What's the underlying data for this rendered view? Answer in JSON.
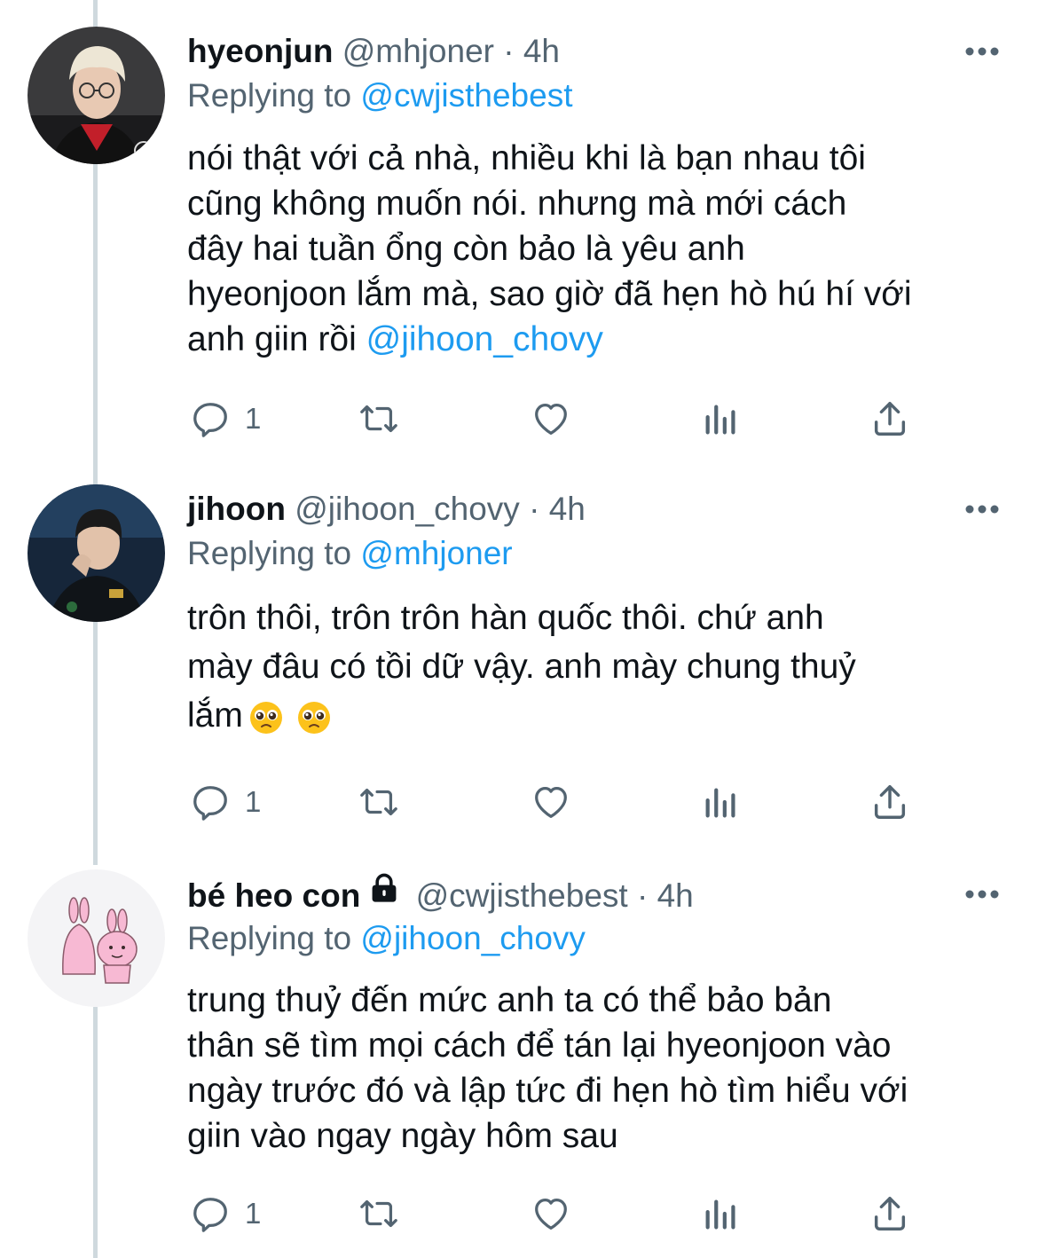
{
  "tweets": [
    {
      "name": "hyeonjun",
      "handle": "@mhjoner",
      "sep": "·",
      "time": "4h",
      "locked": false,
      "replying_prefix": "Replying to ",
      "replying_to": "@cwjisthebest",
      "body_text": "nói thật với cả nhà, nhiều khi là bạn nhau tôi\ncũng không muốn nói. nhưng mà mới cách\nđây hai tuần ổng còn bảo là yêu anh\nhyeonjoon lắm mà, sao giờ đã hẹn hò hú hí với\nanh giin rồi ",
      "body_mention": "@jihoon_chovy",
      "reply_count": "1"
    },
    {
      "name": "jihoon",
      "handle": "@jihoon_chovy",
      "sep": "·",
      "time": "4h",
      "locked": false,
      "replying_prefix": "Replying to ",
      "replying_to": "@mhjoner",
      "body_text": "trôn thôi, trôn trôn hàn quốc thôi. chứ anh\nmày đâu có tồi dữ vậy. anh mày chung thuỷ\nlắm",
      "emoji": [
        "pleading-face-emoji",
        "pleading-face-emoji"
      ],
      "reply_count": "1"
    },
    {
      "name": "bé heo con",
      "handle": "@cwjisthebest",
      "sep": "·",
      "time": "4h",
      "locked": true,
      "replying_prefix": "Replying to ",
      "replying_to": "@jihoon_chovy",
      "body_text": "trung thuỷ đến mức anh ta có thể bảo bản\nthân sẽ tìm mọi cách để tán lại hyeonjoon vào\nngày trước đó và lập tức đi hẹn hò tìm hiểu với\ngiin vào ngay ngày hôm sau",
      "reply_count": "1"
    }
  ],
  "icons": [
    "reply-icon",
    "retweet-icon",
    "like-icon",
    "analytics-icon",
    "share-icon",
    "more-icon",
    "lock-icon"
  ],
  "colors": {
    "link": "#1d9bf0",
    "muted": "#536471",
    "text": "#0f1419",
    "thread_line": "#cfd9de"
  }
}
